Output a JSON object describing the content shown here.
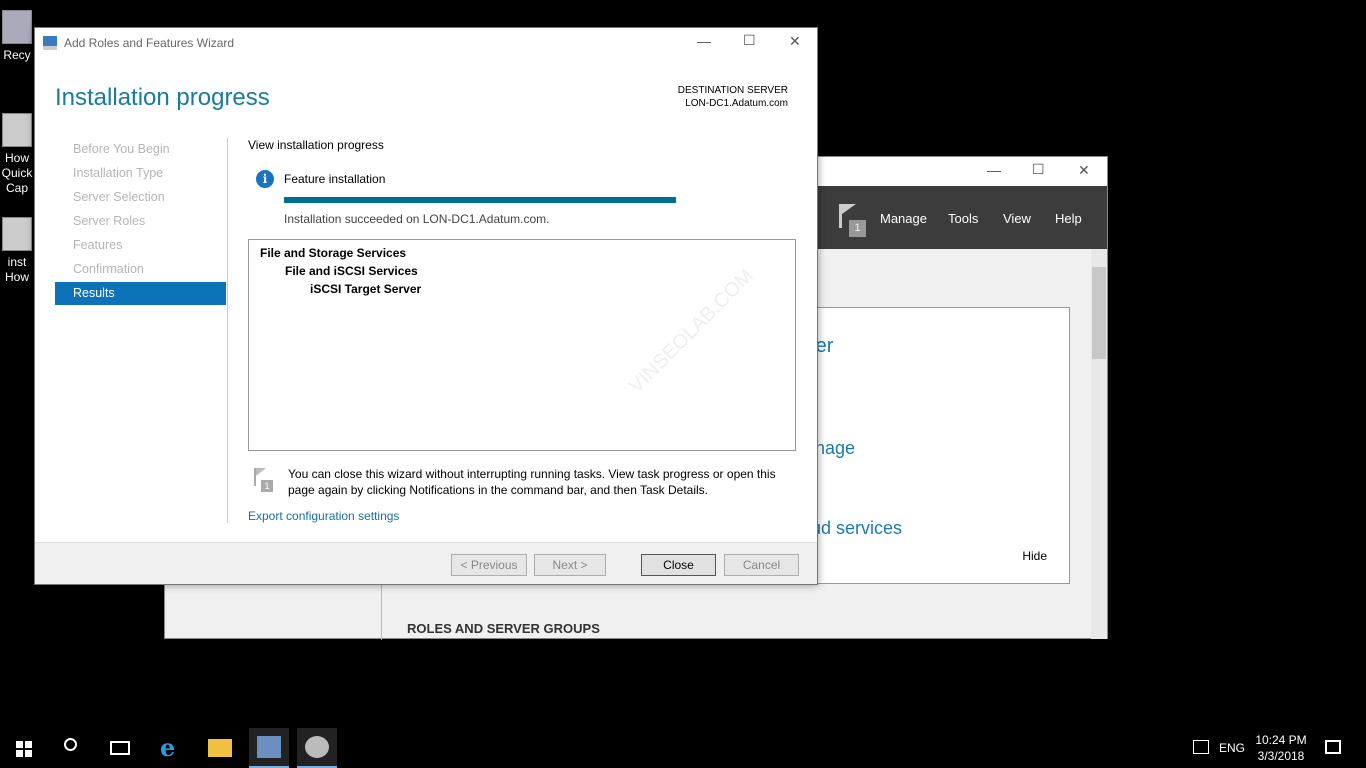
{
  "desktop": {
    "icons": [
      {
        "label": "Recy"
      },
      {
        "label": "How Quick Cap"
      },
      {
        "label": "inst How"
      }
    ]
  },
  "server_manager": {
    "controls": {
      "minimize": "—",
      "maximize": "☐",
      "close": "✕"
    },
    "notification_count": "1",
    "menu": [
      "Manage",
      "Tools",
      "View",
      "Help"
    ],
    "links": [
      "rver",
      "nage",
      "oud services"
    ],
    "hide_label": "Hide",
    "section_title": "ROLES AND SERVER GROUPS"
  },
  "wizard": {
    "title": "Add Roles and Features Wizard",
    "controls": {
      "minimize": "—",
      "maximize": "☐",
      "close": "✕"
    },
    "heading": "Installation progress",
    "destination_label": "DESTINATION SERVER",
    "destination_server": "LON-DC1.Adatum.com",
    "nav": [
      "Before You Begin",
      "Installation Type",
      "Server Selection",
      "Server Roles",
      "Features",
      "Confirmation",
      "Results"
    ],
    "active_nav": "Results",
    "view_label": "View installation progress",
    "feature_label": "Feature installation",
    "progress_percent": 100,
    "progress_color": "#00708f",
    "status": "Installation succeeded on LON-DC1.Adatum.com.",
    "results_tree": [
      "File and Storage Services",
      "File and iSCSI Services",
      "iSCSI Target Server"
    ],
    "note": "You can close this wizard without interrupting running tasks. View task progress or open this page again by clicking Notifications in the command bar, and then Task Details.",
    "note_badge": "1",
    "export_link": "Export configuration settings",
    "buttons": {
      "previous": "< Previous",
      "next": "Next >",
      "close": "Close",
      "cancel": "Cancel"
    },
    "watermark": "VINSEOLAB.COM"
  },
  "taskbar": {
    "language": "ENG",
    "time": "10:24 PM",
    "date": "3/3/2018"
  }
}
